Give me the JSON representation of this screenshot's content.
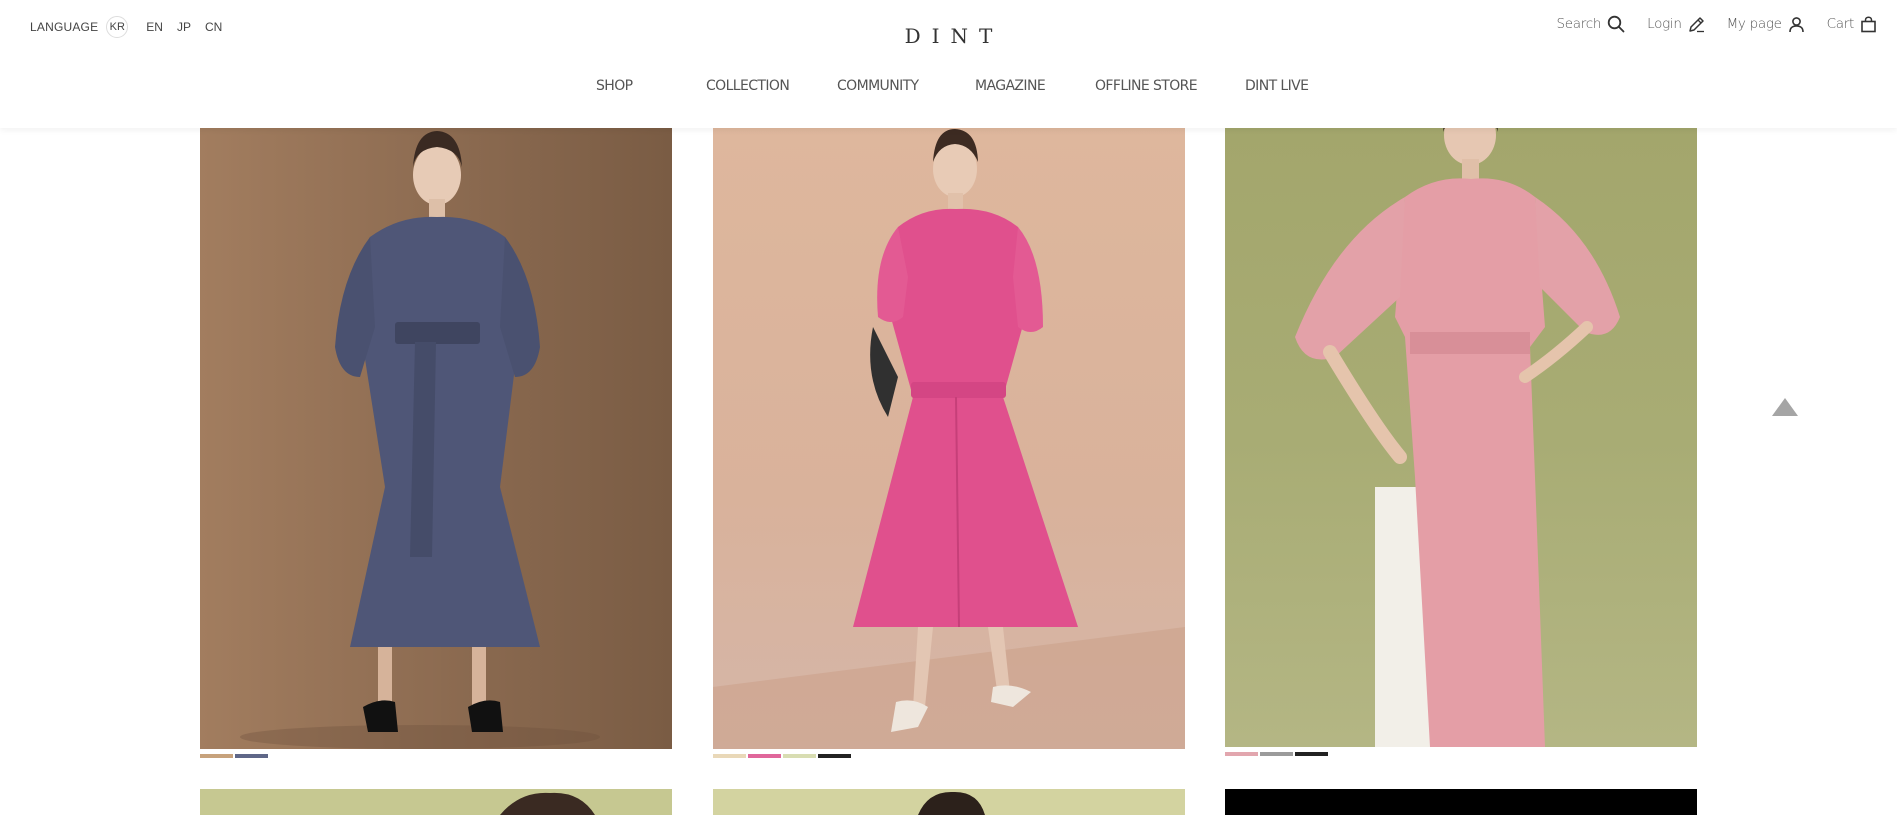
{
  "language": {
    "label": "LANGUAGE",
    "options": [
      "KR",
      "EN",
      "JP",
      "CN"
    ],
    "active": "KR"
  },
  "logo": "DINT",
  "utility": {
    "search": "Search",
    "login": "Login",
    "mypage": "My page",
    "cart": "Cart"
  },
  "nav": [
    "SHOP",
    "COLLECTION",
    "COMMUNITY",
    "MAGAZINE",
    "OFFLINE STORE",
    "DINT LIVE"
  ],
  "products": [
    {
      "image": "model-in-navy-belted-dress",
      "background": "#96745a",
      "swatches": [
        "#c7a27c",
        "#5f6788"
      ]
    },
    {
      "image": "model-in-pink-belted-coat-dress",
      "background": "#d8b29a",
      "swatches": [
        "#e9d8b8",
        "#e0679b",
        "#d8ddb2",
        "#222222"
      ]
    },
    {
      "image": "model-in-pink-sheath-dress",
      "background": "#a9ad74",
      "swatches": [
        "#e2a6ae",
        "#9b9b9b",
        "#222222"
      ]
    }
  ],
  "next_row": [
    {
      "image": "model-portrait",
      "background": "#c6c891"
    },
    {
      "image": "model-portrait",
      "background": "#d3d3a0"
    },
    {
      "image": "black-banner",
      "background": "#000000"
    }
  ],
  "colors": {
    "accent": "#333333",
    "text_muted": "#666666"
  }
}
